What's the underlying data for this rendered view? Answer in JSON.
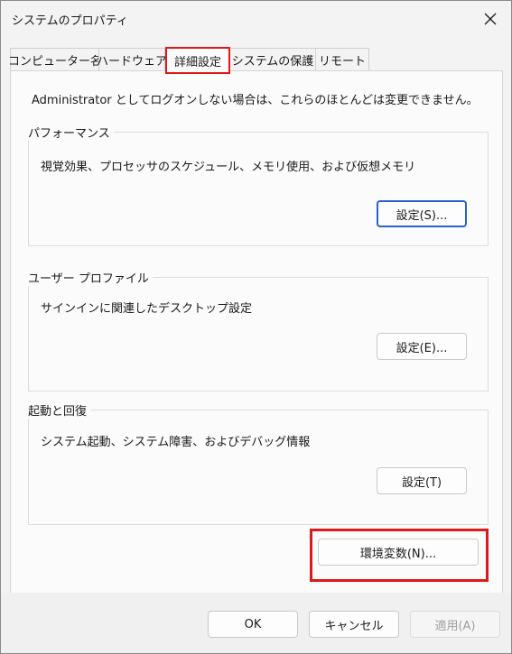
{
  "window": {
    "title": "システムのプロパティ",
    "close_icon": "close-icon"
  },
  "tabs": [
    {
      "label": "コンピューター名",
      "active": false
    },
    {
      "label": "ハードウェア",
      "active": false
    },
    {
      "label": "詳細設定",
      "active": true
    },
    {
      "label": "システムの保護",
      "active": false
    },
    {
      "label": "リモート",
      "active": false
    }
  ],
  "intro": "Administrator としてログオンしない場合は、これらのほとんどは変更できません。",
  "performance": {
    "title": "パフォーマンス",
    "description": "視覚効果、プロセッサのスケジュール、メモリ使用、および仮想メモリ",
    "button": "設定(S)..."
  },
  "user_profiles": {
    "title": "ユーザー プロファイル",
    "description": "サインインに関連したデスクトップ設定",
    "button": "設定(E)..."
  },
  "startup_recovery": {
    "title": "起動と回復",
    "description": "システム起動、システム障害、およびデバッグ情報",
    "button": "設定(T)"
  },
  "env_button": "環境変数(N)...",
  "footer": {
    "ok": "OK",
    "cancel": "キャンセル",
    "apply": "適用(A)"
  },
  "colors": {
    "highlight": "#e01818",
    "primary_border": "#2b63c9"
  }
}
